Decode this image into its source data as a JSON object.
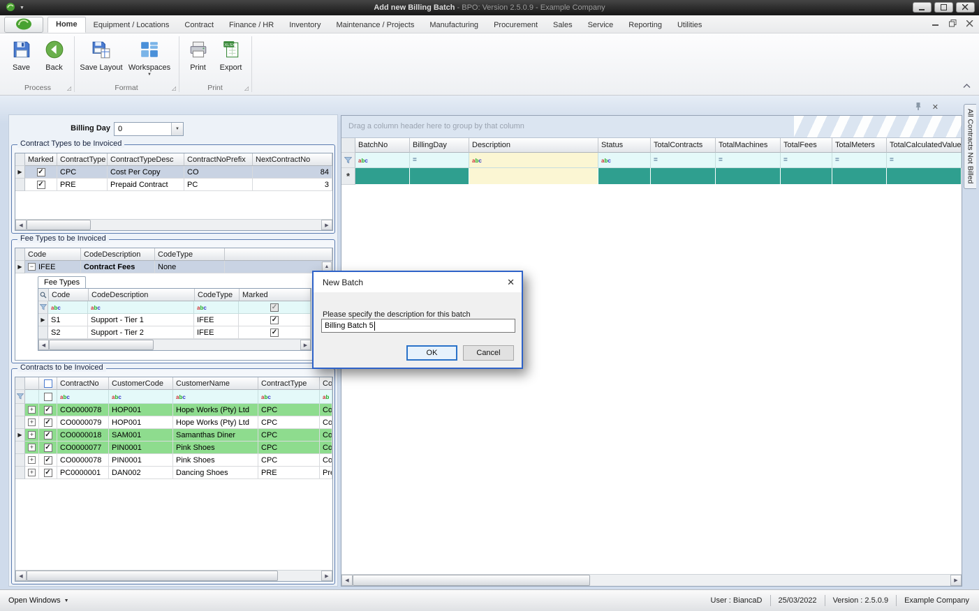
{
  "titlebar": {
    "title": "Add new Billing Batch",
    "subtitle": " - BPO: Version 2.5.0.9 - Example Company"
  },
  "tabs": [
    "Home",
    "Equipment / Locations",
    "Contract",
    "Finance / HR",
    "Inventory",
    "Maintenance / Projects",
    "Manufacturing",
    "Procurement",
    "Sales",
    "Service",
    "Reporting",
    "Utilities"
  ],
  "ribbon": {
    "save": "Save",
    "back": "Back",
    "save_layout": "Save Layout",
    "workspaces": "Workspaces",
    "print": "Print",
    "export": "Export",
    "group_process": "Process",
    "group_format": "Format",
    "group_print": "Print"
  },
  "left": {
    "billing_day_label": "Billing Day",
    "billing_day_value": "0",
    "contract_types": {
      "title": "Contract Types to be Invoiced",
      "col_marked": "Marked",
      "col_type": "ContractType",
      "col_desc": "ContractTypeDesc",
      "col_prefix": "ContractNoPrefix",
      "col_next": "NextContractNo",
      "rows": [
        {
          "marked": true,
          "type": "CPC",
          "desc": "Cost Per Copy",
          "prefix": "CO",
          "next": "84"
        },
        {
          "marked": true,
          "type": "PRE",
          "desc": "Prepaid Contract",
          "prefix": "PC",
          "next": "3"
        }
      ]
    },
    "fee_types": {
      "title": "Fee Types to be Invoiced",
      "col_code": "Code",
      "col_desc": "CodeDescription",
      "col_type": "CodeType",
      "master": {
        "expanded": true,
        "code": "IFEE",
        "desc": "Contract Fees",
        "type": "None"
      },
      "detail_tab": "Fee Types",
      "detail": {
        "col_code": "Code",
        "col_desc": "CodeDescription",
        "col_type": "CodeType",
        "col_marked": "Marked",
        "rows": [
          {
            "code": "S1",
            "desc": "Support - Tier 1",
            "type": "IFEE",
            "marked": true
          },
          {
            "code": "S2",
            "desc": "Support - Tier 2",
            "type": "IFEE",
            "marked": true
          }
        ]
      }
    },
    "contracts": {
      "title": "Contracts to be Invoiced",
      "col_no": "ContractNo",
      "col_code": "CustomerCode",
      "col_name": "CustomerName",
      "col_type": "ContractType",
      "col_extra": "Con",
      "rows": [
        {
          "checked": true,
          "no": "CO0000078",
          "code": "HOP001",
          "name": "Hope Works (Pty) Ltd",
          "type": "CPC",
          "extra": "Cost",
          "highlight": true
        },
        {
          "checked": true,
          "no": "CO0000079",
          "code": "HOP001",
          "name": "Hope Works (Pty) Ltd",
          "type": "CPC",
          "extra": "Cost",
          "highlight": false
        },
        {
          "checked": true,
          "no": "CO0000018",
          "code": "SAM001",
          "name": "Samanthas Diner",
          "type": "CPC",
          "extra": "Cost",
          "highlight": true
        },
        {
          "checked": true,
          "no": "CO0000077",
          "code": "PIN0001",
          "name": "Pink Shoes",
          "type": "CPC",
          "extra": "Cost",
          "highlight": true
        },
        {
          "checked": true,
          "no": "CO0000078",
          "code": "PIN0001",
          "name": "Pink Shoes",
          "type": "CPC",
          "extra": "Cost",
          "highlight": false
        },
        {
          "checked": true,
          "no": "PC0000001",
          "code": "DAN002",
          "name": "Dancing Shoes",
          "type": "PRE",
          "extra": "Prep",
          "highlight": false
        }
      ]
    }
  },
  "batches": {
    "group_hint": "Drag a column header here to group by that column",
    "columns": [
      "BatchNo",
      "BillingDay",
      "Description",
      "Status",
      "TotalContracts",
      "TotalMachines",
      "TotalFees",
      "TotalMeters",
      "TotalCalculatedValue"
    ],
    "filter_types": [
      "text",
      "number",
      "text",
      "text",
      "number",
      "number",
      "number",
      "number",
      "number"
    ]
  },
  "side_tab": "All Contracts Not Billed",
  "dialog": {
    "title": "New Batch",
    "prompt": "Please specify the description for this batch",
    "value": "Billing Batch 5",
    "ok": "OK",
    "cancel": "Cancel"
  },
  "statusbar": {
    "open_windows": "Open Windows",
    "user": "User : BiancaD",
    "date": "25/03/2022",
    "version": "Version : 2.5.0.9",
    "company": "Example Company"
  },
  "colors": {
    "new_row_teal": "#2f9f8f",
    "row_green": "#8edc8e",
    "filter_cyan": "#e4f9f9",
    "filter_yellow": "#fbf6d3",
    "dialog_border": "#2e62c8",
    "selected_row": "#c9d3e3"
  }
}
